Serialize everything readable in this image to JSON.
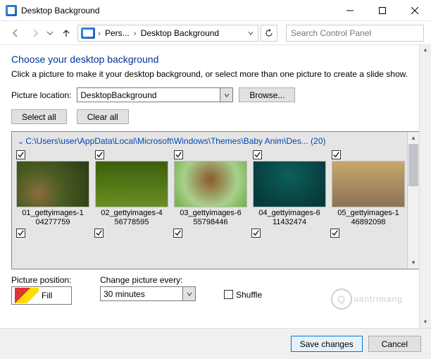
{
  "window": {
    "title": "Desktop Background"
  },
  "nav": {
    "crumb1": "Pers...",
    "crumb2": "Desktop Background",
    "search_placeholder": "Search Control Panel"
  },
  "page": {
    "heading": "Choose your desktop background",
    "subtext": "Click a picture to make it your desktop background, or select more than one picture to create a slide show."
  },
  "location": {
    "label": "Picture location:",
    "value": "DesktopBackground",
    "browse": "Browse..."
  },
  "selection": {
    "select_all": "Select all",
    "clear_all": "Clear all"
  },
  "gallery": {
    "path": "C:\\Users\\user\\AppData\\Local\\Microsoft\\Windows\\Themes\\Baby Anim\\Des... (20)",
    "items": [
      {
        "name": "01_gettyimages-1\n04277759"
      },
      {
        "name": "02_gettyimages-4\n56778595"
      },
      {
        "name": "03_gettyimages-6\n55798446"
      },
      {
        "name": "04_gettyimages-6\n11432474"
      },
      {
        "name": "05_gettyimages-1\n46892098"
      }
    ]
  },
  "position": {
    "label": "Picture position:",
    "value": "Fill"
  },
  "change": {
    "label": "Change picture every:",
    "value": "30 minutes"
  },
  "shuffle": {
    "label": "Shuffle"
  },
  "footer": {
    "save": "Save changes",
    "cancel": "Cancel"
  },
  "watermark": "uantrimang"
}
